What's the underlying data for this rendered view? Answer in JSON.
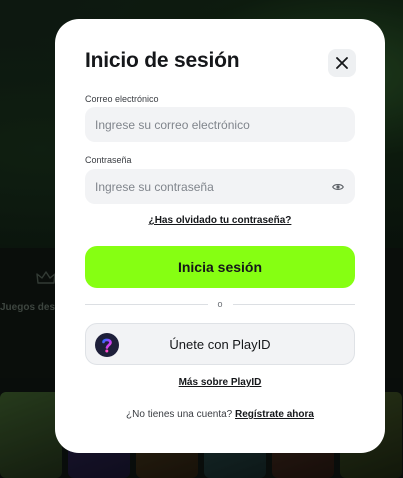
{
  "background": {
    "nav_label": "Juegos des"
  },
  "modal": {
    "title": "Inicio de sesión",
    "email": {
      "label": "Correo electrónico",
      "placeholder": "Ingrese su correo electrónico",
      "value": ""
    },
    "password": {
      "label": "Contraseña",
      "placeholder": "Ingrese su contraseña",
      "value": ""
    },
    "forgot_password": "¿Has olvidado tu contraseña?",
    "login_button": "Inicia sesión",
    "divider": "o",
    "playid_button": "Únete con PlayID",
    "more_playid": "Más sobre PlayID",
    "signup_prompt": "¿No tienes una cuenta?",
    "signup_link": "Regístrate ahora"
  },
  "colors": {
    "accent": "#86ff12",
    "playid_gradient": [
      "#2f6bff",
      "#b23cff",
      "#ff4ecb"
    ]
  },
  "icons": {
    "close": "close-icon",
    "eye": "eye-icon",
    "playid": "playid-logo-icon",
    "crown": "crown-icon"
  }
}
